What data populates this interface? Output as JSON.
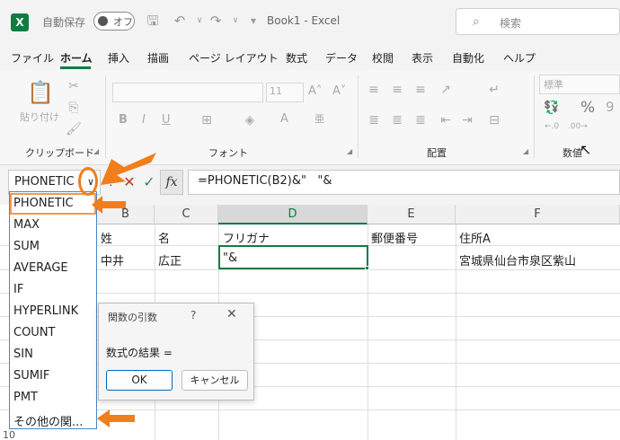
{
  "titlebar": {
    "autosave_label": "自動保存",
    "toggle_state": "オフ",
    "document_title": "Book1  -  Excel",
    "search_placeholder": "検索"
  },
  "menu": [
    "ファイル",
    "ホーム",
    "挿入",
    "描画",
    "ページ レイアウト",
    "数式",
    "データ",
    "校閲",
    "表示",
    "自動化",
    "ヘルプ"
  ],
  "active_menu": "ホーム",
  "ribbon": {
    "clipboard_label": "クリップボード",
    "paste_label": "貼り付け",
    "font_label": "フォント",
    "font_size": "11",
    "align_label": "配置",
    "number_label": "数値",
    "number_format": "標準"
  },
  "formula_bar": {
    "name_box": "PHONETIC",
    "formula": "=PHONETIC(B2)&\"   \"&",
    "fx": "fx"
  },
  "columns": [
    "B",
    "C",
    "D",
    "E",
    "F"
  ],
  "selected_column": "D",
  "cells": {
    "B1": "姓",
    "C1": "名",
    "D1": "フリガナ",
    "E1": "郵便番号",
    "F1": "住所A",
    "B2": "中井",
    "C2": "広正",
    "D2": "\"&",
    "F2": "宮城県仙台市泉区紫山"
  },
  "row_number_visible": "10",
  "function_list": [
    "PHONETIC",
    "MAX",
    "SUM",
    "AVERAGE",
    "IF",
    "HYPERLINK",
    "COUNT",
    "SIN",
    "SUMIF",
    "PMT",
    "その他の関..."
  ],
  "dialog": {
    "title": "関数の引数",
    "help": "?",
    "result_label": "数式の結果 =",
    "ok": "OK",
    "cancel": "キャンセル"
  },
  "colors": {
    "excel_green": "#107c41",
    "callout_orange": "#f07e1a",
    "dropdown_border": "#4a86c8"
  }
}
